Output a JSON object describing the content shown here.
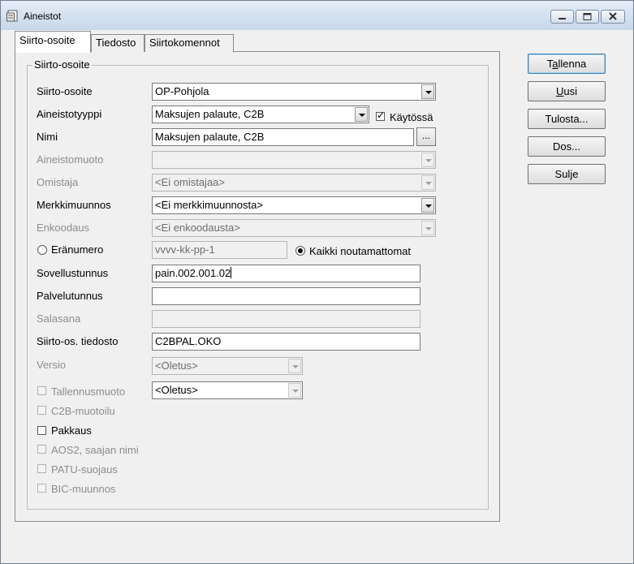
{
  "window": {
    "title": "Aineistot"
  },
  "tabs": [
    {
      "label": "Siirto-osoite",
      "active": true
    },
    {
      "label": "Tiedosto",
      "active": false
    },
    {
      "label": "Siirtokomennot",
      "active": false
    }
  ],
  "group": {
    "legend": "Siirto-osoite"
  },
  "form": {
    "siirto_osoite": {
      "label": "Siirto-osoite",
      "value": "OP-Pohjola"
    },
    "aineistotyyppi": {
      "label": "Aineistotyyppi",
      "value": "Maksujen palaute, C2B"
    },
    "kaytossa": {
      "label": "Käytössä",
      "checked": true
    },
    "nimi": {
      "label": "Nimi",
      "value": "Maksujen palaute, C2B",
      "button": "..."
    },
    "aineistomuoto": {
      "label": "Aineistomuoto",
      "value": ""
    },
    "omistaja": {
      "label": "Omistaja",
      "value": "<Ei omistajaa>"
    },
    "merkkimuunnos": {
      "label": "Merkkimuunnos",
      "value": "<Ei merkkimuunnosta>"
    },
    "enkoodaus": {
      "label": "Enkoodaus",
      "value": "<Ei enkoodausta>"
    },
    "eranumero": {
      "label": "Eränumero",
      "placeholder": "vvvv-kk-pp-1",
      "selected": false
    },
    "kaikki": {
      "label": "Kaikki noutamattomat",
      "selected": true
    },
    "sovellustunnus": {
      "label": "Sovellustunnus",
      "value": "pain.002.001.02"
    },
    "palvelutunnus": {
      "label": "Palvelutunnus",
      "value": ""
    },
    "salasana": {
      "label": "Salasana",
      "value": ""
    },
    "siirto_os_tiedosto": {
      "label": "Siirto-os. tiedosto",
      "value": "C2BPAL.OKO"
    },
    "versio": {
      "label": "Versio",
      "value": "<Oletus>"
    },
    "tallennusmuoto": {
      "label": "Tallennusmuoto",
      "value": "<Oletus>"
    },
    "c2b_muotoilu": {
      "label": "C2B-muotoilu"
    },
    "pakkaus": {
      "label": "Pakkaus"
    },
    "aos2": {
      "label": "AOS2, saajan nimi"
    },
    "patu": {
      "label": "PATU-suojaus"
    },
    "bic": {
      "label": "BIC-muunnos"
    }
  },
  "buttons": {
    "tallenna_pre": "T",
    "tallenna_u": "a",
    "tallenna_post": "llenna",
    "uusi_u": "U",
    "uusi_post": "usi",
    "tulosta": "Tulosta...",
    "dos": "Dos...",
    "sulje": "Sulje"
  }
}
